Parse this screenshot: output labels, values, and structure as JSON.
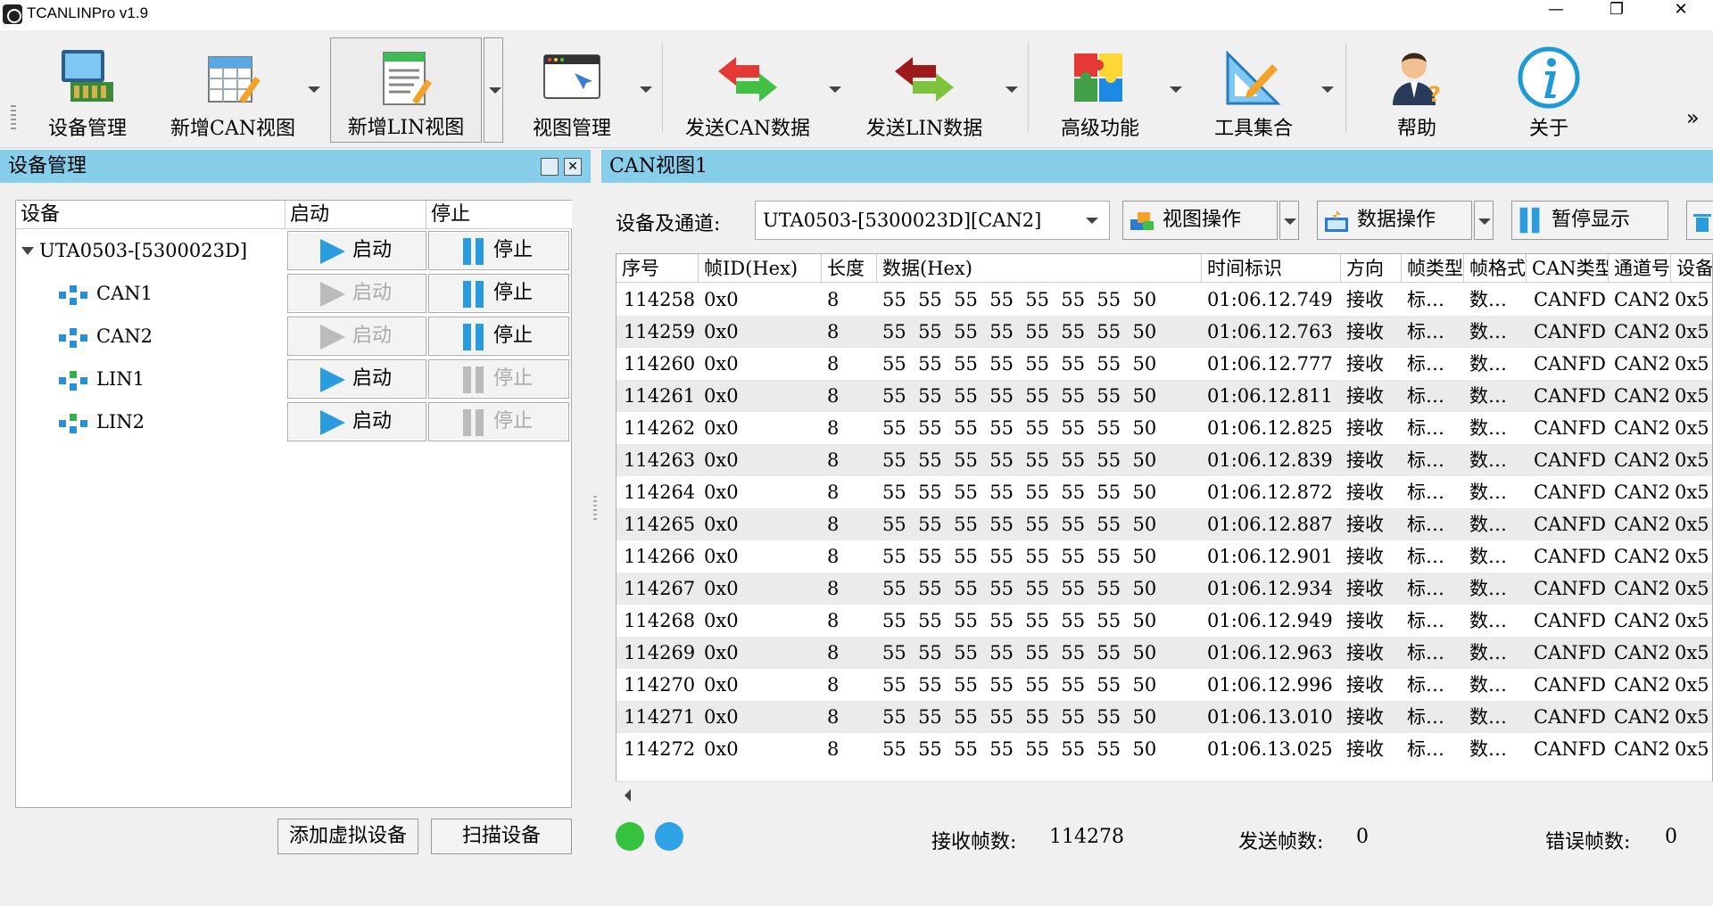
{
  "window": {
    "title": "TCANLINPro v1.9",
    "minimize": "—",
    "restore": "❐",
    "close": "✕"
  },
  "toolbar": {
    "items": [
      {
        "label": "设备管理",
        "icon": "device-manager-icon"
      },
      {
        "label": "新增CAN视图",
        "icon": "new-can-view-icon"
      },
      {
        "label": "新增LIN视图",
        "icon": "new-lin-view-icon"
      },
      {
        "label": "视图管理",
        "icon": "view-manager-icon"
      },
      {
        "label": "发送CAN数据",
        "icon": "send-can-icon"
      },
      {
        "label": "发送LIN数据",
        "icon": "send-lin-icon"
      },
      {
        "label": "高级功能",
        "icon": "puzzle-icon"
      },
      {
        "label": "工具集合",
        "icon": "tools-icon"
      },
      {
        "label": "帮助",
        "icon": "help-icon"
      },
      {
        "label": "关于",
        "icon": "about-icon"
      }
    ],
    "more": "»"
  },
  "left_panel": {
    "title": "设备管理",
    "columns": [
      "设备",
      "启动",
      "停止"
    ],
    "devices": [
      {
        "name": "UTA0503-[5300023D]",
        "start": "启动",
        "stop": "停止",
        "start_enabled": true,
        "stop_enabled": true
      },
      {
        "name": "CAN1",
        "start": "启动",
        "stop": "停止",
        "start_enabled": false,
        "stop_enabled": true
      },
      {
        "name": "CAN2",
        "start": "启动",
        "stop": "停止",
        "start_enabled": false,
        "stop_enabled": true
      },
      {
        "name": "LIN1",
        "start": "启动",
        "stop": "停止",
        "start_enabled": true,
        "stop_enabled": false
      },
      {
        "name": "LIN2",
        "start": "启动",
        "stop": "停止",
        "start_enabled": true,
        "stop_enabled": false
      }
    ],
    "add_virtual": "添加虚拟设备",
    "scan": "扫描设备"
  },
  "right_panel": {
    "title": "CAN视图1",
    "channel_label": "设备及通道:",
    "channel_value": "UTA0503-[5300023D][CAN2]",
    "view_ops": "视图操作",
    "data_ops": "数据操作",
    "pause": "暂停显示",
    "columns": [
      "序号",
      "帧ID(Hex)",
      "长度",
      "数据(Hex)",
      "时间标识",
      "方向",
      "帧类型",
      "帧格式",
      "CAN类型",
      "通道号",
      "设备"
    ],
    "rows": [
      [
        "114258",
        "0x0",
        "8",
        "55  55  55  55  55  55  55  50",
        "01:06.12.749",
        "接收",
        "标…",
        "数…",
        "CANFD",
        "CAN2",
        "0x5"
      ],
      [
        "114259",
        "0x0",
        "8",
        "55  55  55  55  55  55  55  50",
        "01:06.12.763",
        "接收",
        "标…",
        "数…",
        "CANFD",
        "CAN2",
        "0x5"
      ],
      [
        "114260",
        "0x0",
        "8",
        "55  55  55  55  55  55  55  50",
        "01:06.12.777",
        "接收",
        "标…",
        "数…",
        "CANFD",
        "CAN2",
        "0x5"
      ],
      [
        "114261",
        "0x0",
        "8",
        "55  55  55  55  55  55  55  50",
        "01:06.12.811",
        "接收",
        "标…",
        "数…",
        "CANFD",
        "CAN2",
        "0x5"
      ],
      [
        "114262",
        "0x0",
        "8",
        "55  55  55  55  55  55  55  50",
        "01:06.12.825",
        "接收",
        "标…",
        "数…",
        "CANFD",
        "CAN2",
        "0x5"
      ],
      [
        "114263",
        "0x0",
        "8",
        "55  55  55  55  55  55  55  50",
        "01:06.12.839",
        "接收",
        "标…",
        "数…",
        "CANFD",
        "CAN2",
        "0x5"
      ],
      [
        "114264",
        "0x0",
        "8",
        "55  55  55  55  55  55  55  50",
        "01:06.12.872",
        "接收",
        "标…",
        "数…",
        "CANFD",
        "CAN2",
        "0x5"
      ],
      [
        "114265",
        "0x0",
        "8",
        "55  55  55  55  55  55  55  50",
        "01:06.12.887",
        "接收",
        "标…",
        "数…",
        "CANFD",
        "CAN2",
        "0x5"
      ],
      [
        "114266",
        "0x0",
        "8",
        "55  55  55  55  55  55  55  50",
        "01:06.12.901",
        "接收",
        "标…",
        "数…",
        "CANFD",
        "CAN2",
        "0x5"
      ],
      [
        "114267",
        "0x0",
        "8",
        "55  55  55  55  55  55  55  50",
        "01:06.12.934",
        "接收",
        "标…",
        "数…",
        "CANFD",
        "CAN2",
        "0x5"
      ],
      [
        "114268",
        "0x0",
        "8",
        "55  55  55  55  55  55  55  50",
        "01:06.12.949",
        "接收",
        "标…",
        "数…",
        "CANFD",
        "CAN2",
        "0x5"
      ],
      [
        "114269",
        "0x0",
        "8",
        "55  55  55  55  55  55  55  50",
        "01:06.12.963",
        "接收",
        "标…",
        "数…",
        "CANFD",
        "CAN2",
        "0x5"
      ],
      [
        "114270",
        "0x0",
        "8",
        "55  55  55  55  55  55  55  50",
        "01:06.12.996",
        "接收",
        "标…",
        "数…",
        "CANFD",
        "CAN2",
        "0x5"
      ],
      [
        "114271",
        "0x0",
        "8",
        "55  55  55  55  55  55  55  50",
        "01:06.13.010",
        "接收",
        "标…",
        "数…",
        "CANFD",
        "CAN2",
        "0x5"
      ],
      [
        "114272",
        "0x0",
        "8",
        "55  55  55  55  55  55  55  50",
        "01:06.13.025",
        "接收",
        "标…",
        "数…",
        "CANFD",
        "CAN2",
        "0x5"
      ]
    ],
    "status": {
      "rx_label": "接收帧数:",
      "rx_value": "114278",
      "tx_label": "发送帧数:",
      "tx_value": "0",
      "err_label": "错误帧数:",
      "err_value": "0",
      "led1_color": "#35c23c",
      "led2_color": "#2fa3e6"
    }
  },
  "colors": {
    "panel_header": "#87ceeb",
    "accent_blue": "#2b9be0"
  }
}
